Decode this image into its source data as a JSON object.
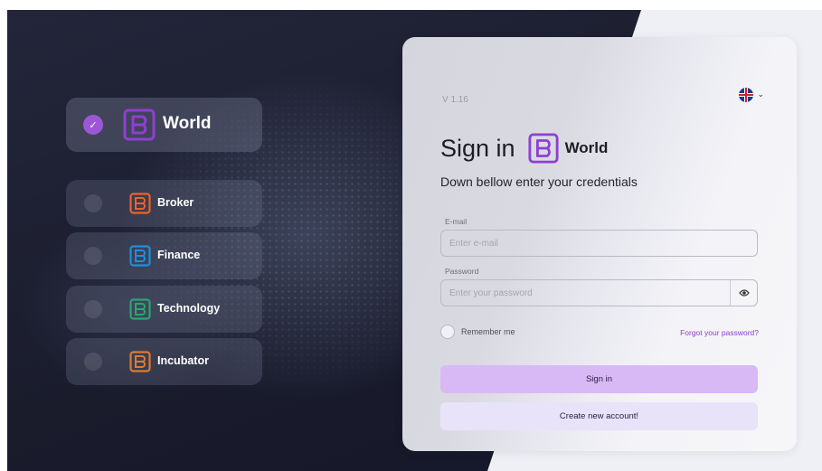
{
  "app": {
    "version": "V 1.16",
    "language": "English"
  },
  "brands": [
    {
      "id": "world",
      "label": "World",
      "color": "#8e3fd1",
      "selected": true
    },
    {
      "id": "broker",
      "label": "Broker",
      "color": "#e9642c",
      "selected": false
    },
    {
      "id": "finance",
      "label": "Finance",
      "color": "#1e8fdd",
      "selected": false
    },
    {
      "id": "technology",
      "label": "Technology",
      "color": "#26a86c",
      "selected": false
    },
    {
      "id": "incubator",
      "label": "Incubator",
      "color": "#e07a2d",
      "selected": false
    }
  ],
  "form": {
    "title": "Sign in",
    "brand_label": "World",
    "subtitle": "Down bellow enter your credentials",
    "email": {
      "label": "E-mail",
      "placeholder": "Enter e-mail",
      "value": ""
    },
    "password": {
      "label": "Password",
      "placeholder": "Enter your password",
      "value": ""
    },
    "remember_label": "Remember me",
    "forgot_label": "Forgot your password?",
    "signin_label": "Sign in",
    "create_label": "Create new account!"
  },
  "colors": {
    "accent": "#8e3fd1",
    "signin_button": "#d8b9f6",
    "create_button": "#e8e3f8"
  }
}
